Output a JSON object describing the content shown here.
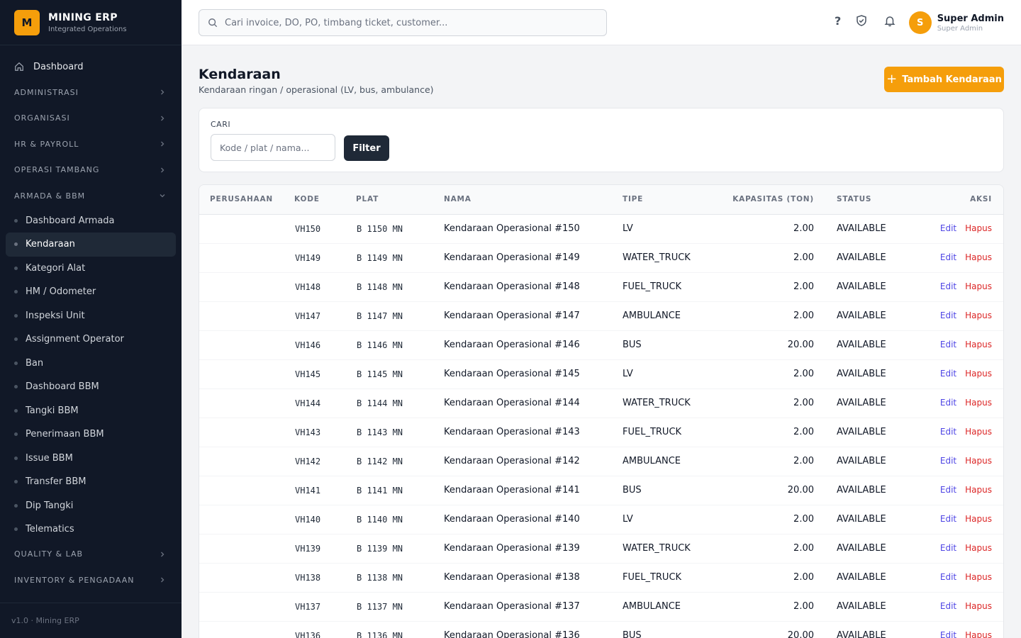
{
  "brand": {
    "logo_letter": "M",
    "title": "MINING ERP",
    "subtitle": "Integrated Operations"
  },
  "sidebar": {
    "dashboard": "Dashboard",
    "sections_top": [
      {
        "label": "ADMINISTRASI",
        "icon": "chevron-right-icon"
      },
      {
        "label": "ORGANISASI",
        "icon": "chevron-right-icon"
      },
      {
        "label": "HR & PAYROLL",
        "icon": "chevron-right-icon"
      },
      {
        "label": "OPERASI TAMBANG",
        "icon": "chevron-right-icon"
      }
    ],
    "open_section": {
      "label": "ARMADA & BBM",
      "icon": "chevron-down-icon"
    },
    "items": [
      "Dashboard Armada",
      "Kendaraan",
      "Kategori Alat",
      "HM / Odometer",
      "Inspeksi Unit",
      "Assignment Operator",
      "Ban",
      "Dashboard BBM",
      "Tangki BBM",
      "Penerimaan BBM",
      "Issue BBM",
      "Transfer BBM",
      "Dip Tangki",
      "Telematics"
    ],
    "active_item": "Kendaraan",
    "sections_bottom": [
      {
        "label": "QUALITY & LAB",
        "icon": "chevron-right-icon"
      },
      {
        "label": "INVENTORY & PENGADAAN",
        "icon": "chevron-right-icon"
      }
    ],
    "footer": "v1.0 · Mining ERP"
  },
  "topbar": {
    "search_placeholder": "Cari invoice, DO, PO, timbang ticket, customer...",
    "user_initial": "S",
    "user_name": "Super Admin",
    "user_role": "Super Admin"
  },
  "page": {
    "title": "Kendaraan",
    "subtitle": "Kendaraan ringan / operasional (LV, bus, ambulance)",
    "add_button": "Tambah Kendaraan"
  },
  "filter": {
    "label": "CARI",
    "placeholder": "Kode / plat / nama...",
    "button": "Filter"
  },
  "table": {
    "headers": [
      "PERUSAHAAN",
      "KODE",
      "PLAT",
      "NAMA",
      "TIPE",
      "KAPASITAS (TON)",
      "STATUS",
      "AKSI"
    ],
    "edit_label": "Edit",
    "delete_label": "Hapus",
    "rows": [
      {
        "perusahaan": "",
        "kode": "VH150",
        "plat": "B 1150 MN",
        "nama": "Kendaraan Operasional #150",
        "tipe": "LV",
        "kapasitas": "2.00",
        "status": "AVAILABLE"
      },
      {
        "perusahaan": "",
        "kode": "VH149",
        "plat": "B 1149 MN",
        "nama": "Kendaraan Operasional #149",
        "tipe": "WATER_TRUCK",
        "kapasitas": "2.00",
        "status": "AVAILABLE"
      },
      {
        "perusahaan": "",
        "kode": "VH148",
        "plat": "B 1148 MN",
        "nama": "Kendaraan Operasional #148",
        "tipe": "FUEL_TRUCK",
        "kapasitas": "2.00",
        "status": "AVAILABLE"
      },
      {
        "perusahaan": "",
        "kode": "VH147",
        "plat": "B 1147 MN",
        "nama": "Kendaraan Operasional #147",
        "tipe": "AMBULANCE",
        "kapasitas": "2.00",
        "status": "AVAILABLE"
      },
      {
        "perusahaan": "",
        "kode": "VH146",
        "plat": "B 1146 MN",
        "nama": "Kendaraan Operasional #146",
        "tipe": "BUS",
        "kapasitas": "20.00",
        "status": "AVAILABLE"
      },
      {
        "perusahaan": "",
        "kode": "VH145",
        "plat": "B 1145 MN",
        "nama": "Kendaraan Operasional #145",
        "tipe": "LV",
        "kapasitas": "2.00",
        "status": "AVAILABLE"
      },
      {
        "perusahaan": "",
        "kode": "VH144",
        "plat": "B 1144 MN",
        "nama": "Kendaraan Operasional #144",
        "tipe": "WATER_TRUCK",
        "kapasitas": "2.00",
        "status": "AVAILABLE"
      },
      {
        "perusahaan": "",
        "kode": "VH143",
        "plat": "B 1143 MN",
        "nama": "Kendaraan Operasional #143",
        "tipe": "FUEL_TRUCK",
        "kapasitas": "2.00",
        "status": "AVAILABLE"
      },
      {
        "perusahaan": "",
        "kode": "VH142",
        "plat": "B 1142 MN",
        "nama": "Kendaraan Operasional #142",
        "tipe": "AMBULANCE",
        "kapasitas": "2.00",
        "status": "AVAILABLE"
      },
      {
        "perusahaan": "",
        "kode": "VH141",
        "plat": "B 1141 MN",
        "nama": "Kendaraan Operasional #141",
        "tipe": "BUS",
        "kapasitas": "20.00",
        "status": "AVAILABLE"
      },
      {
        "perusahaan": "",
        "kode": "VH140",
        "plat": "B 1140 MN",
        "nama": "Kendaraan Operasional #140",
        "tipe": "LV",
        "kapasitas": "2.00",
        "status": "AVAILABLE"
      },
      {
        "perusahaan": "",
        "kode": "VH139",
        "plat": "B 1139 MN",
        "nama": "Kendaraan Operasional #139",
        "tipe": "WATER_TRUCK",
        "kapasitas": "2.00",
        "status": "AVAILABLE"
      },
      {
        "perusahaan": "",
        "kode": "VH138",
        "plat": "B 1138 MN",
        "nama": "Kendaraan Operasional #138",
        "tipe": "FUEL_TRUCK",
        "kapasitas": "2.00",
        "status": "AVAILABLE"
      },
      {
        "perusahaan": "",
        "kode": "VH137",
        "plat": "B 1137 MN",
        "nama": "Kendaraan Operasional #137",
        "tipe": "AMBULANCE",
        "kapasitas": "2.00",
        "status": "AVAILABLE"
      },
      {
        "perusahaan": "",
        "kode": "VH136",
        "plat": "B 1136 MN",
        "nama": "Kendaraan Operasional #136",
        "tipe": "BUS",
        "kapasitas": "20.00",
        "status": "AVAILABLE"
      }
    ]
  },
  "colors": {
    "accent": "#f59e0b",
    "sidebar_bg": "#111827",
    "edit_link": "#4f46e5",
    "delete_link": "#dc2626",
    "filter_button": "#1f2937"
  }
}
